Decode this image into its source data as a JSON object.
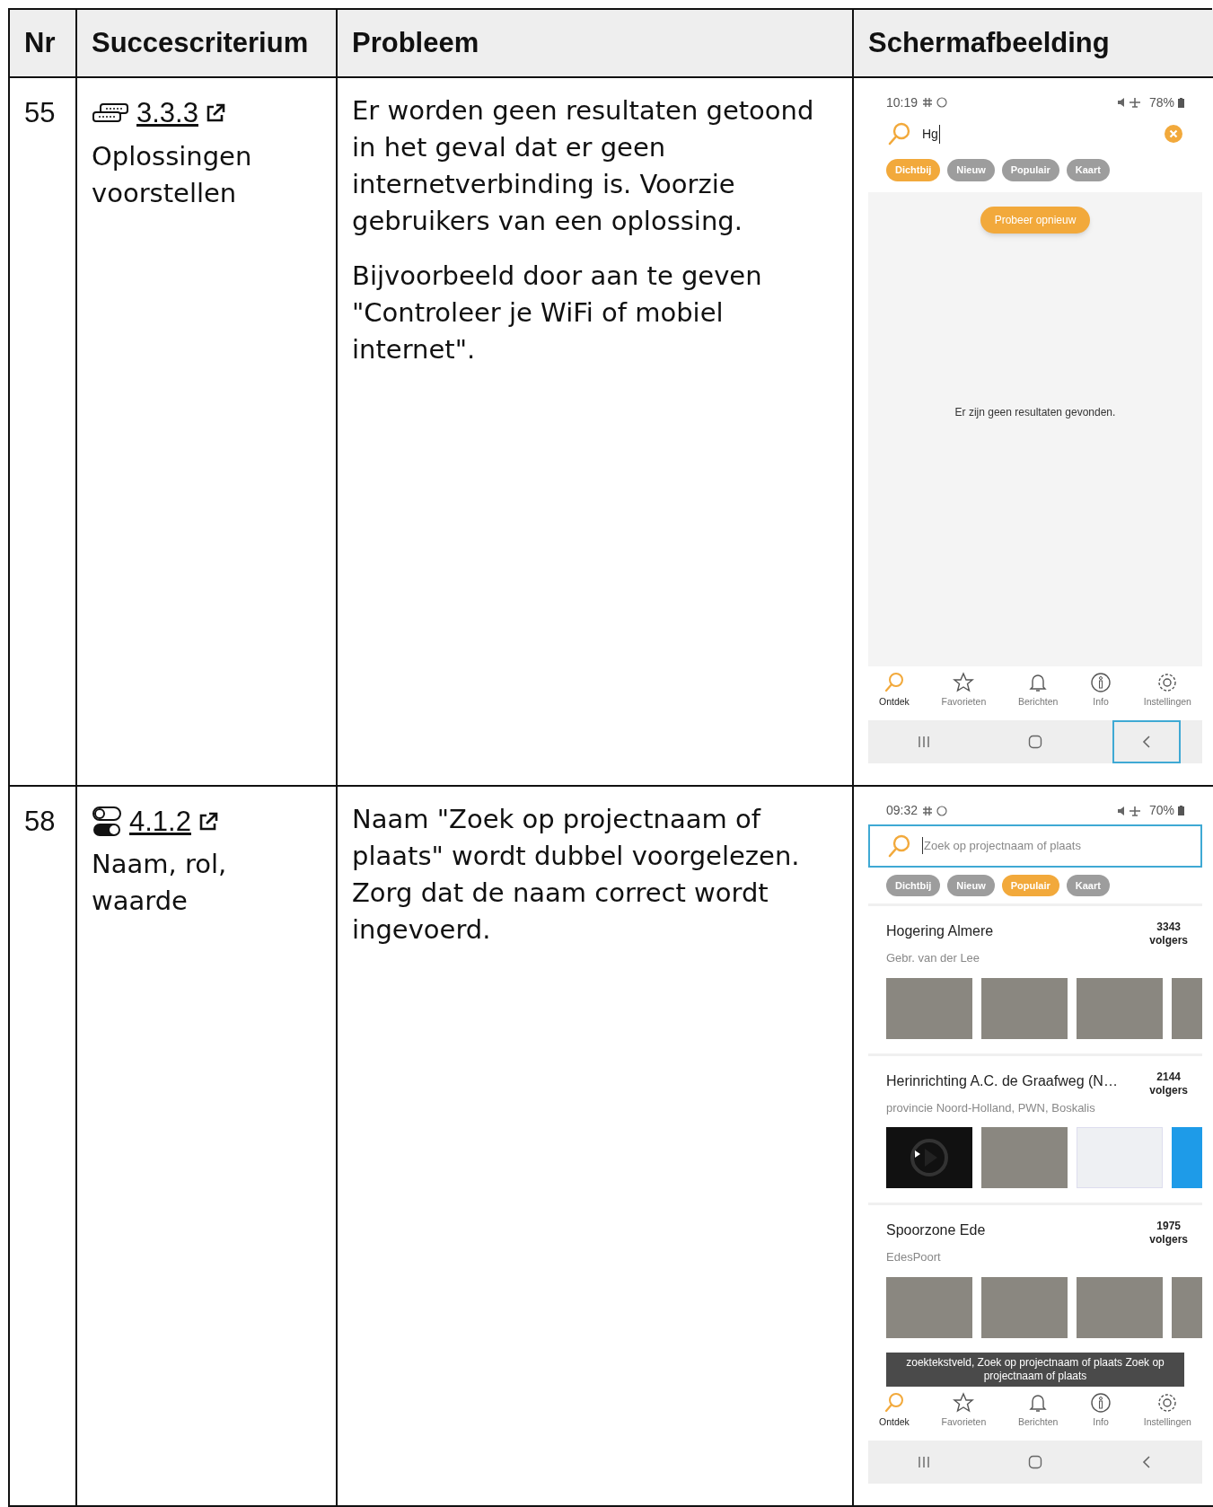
{
  "table": {
    "columns": [
      "Nr",
      "Succescriterium",
      "Probleem",
      "Schermafbeelding"
    ],
    "rows": [
      {
        "nr": "55",
        "criterion": {
          "kind": "chat",
          "number": "3.3.3",
          "name": "Oplossingen voorstellen"
        },
        "problem": [
          "Er worden geen resultaten getoond in het geval dat er geen internetverbinding is. Voorzie gebruikers van een oplossing.",
          "Bijvoorbeeld door aan te geven \"Controleer je WiFi of mobiel internet\"."
        ],
        "screenshot": {
          "kind": "empty",
          "time": "10:19",
          "battery": "78%",
          "search": {
            "value": "Hg",
            "focused": false
          },
          "chips": [
            {
              "label": "Dichtbij",
              "selected": true
            },
            {
              "label": "Nieuw",
              "selected": false
            },
            {
              "label": "Populair",
              "selected": false
            },
            {
              "label": "Kaart",
              "selected": false
            }
          ],
          "retry_button": "Probeer opnieuw",
          "message": "Er zijn geen resultaten gevonden.",
          "nav": [
            {
              "label": "Ontdek",
              "selected": true
            },
            {
              "label": "Favorieten",
              "selected": false
            },
            {
              "label": "Berichten",
              "selected": false
            },
            {
              "label": "Info",
              "selected": false
            },
            {
              "label": "Instellingen",
              "selected": false
            }
          ],
          "back_focused": true
        }
      },
      {
        "nr": "58",
        "criterion": {
          "kind": "toggle",
          "number": "4.1.2",
          "name": "Naam, rol, waarde"
        },
        "problem": [
          "Naam \"Zoek op projectnaam of plaats\" wordt dubbel voorgelezen. Zorg dat de naam correct wordt ingevoerd."
        ],
        "screenshot": {
          "kind": "list",
          "time": "09:32",
          "battery": "70%",
          "search": {
            "placeholder": "Zoek op projectnaam of plaats",
            "focused": true
          },
          "chips": [
            {
              "label": "Dichtbij",
              "selected": false
            },
            {
              "label": "Nieuw",
              "selected": false
            },
            {
              "label": "Populair",
              "selected": true
            },
            {
              "label": "Kaart",
              "selected": false
            }
          ],
          "projects": [
            {
              "title": "Hogering Almere",
              "subtitle": "Gebr. van der Lee",
              "count": "3343",
              "count_label": "volgers",
              "images": [
                {
                  "kind": "photo"
                },
                {
                  "kind": "photo"
                },
                {
                  "kind": "photo"
                },
                {
                  "kind": "photo"
                }
              ]
            },
            {
              "title": "Herinrichting A.C. de Graafweg (N…",
              "subtitle": "provincie Noord-Holland, PWN, Boskalis",
              "count": "2144",
              "count_label": "volgers",
              "images": [
                {
                  "kind": "video"
                },
                {
                  "kind": "photo"
                },
                {
                  "kind": "map"
                },
                {
                  "kind": "tile"
                }
              ]
            },
            {
              "title": "Spoorzone Ede",
              "subtitle": "EdesPoort",
              "count": "1975",
              "count_label": "volgers",
              "images": [
                {
                  "kind": "photo"
                },
                {
                  "kind": "photo"
                },
                {
                  "kind": "photo"
                },
                {
                  "kind": "photo"
                }
              ]
            }
          ],
          "nav": [
            {
              "label": "Ontdek",
              "selected": true
            },
            {
              "label": "Favorieten",
              "selected": false
            },
            {
              "label": "Berichten",
              "selected": false
            },
            {
              "label": "Info",
              "selected": false
            },
            {
              "label": "Instellingen",
              "selected": false
            }
          ],
          "toast": "zoektekstveld, Zoek op projectnaam of plaats Zoek op projectnaam of plaats",
          "back_focused": false
        }
      }
    ]
  }
}
